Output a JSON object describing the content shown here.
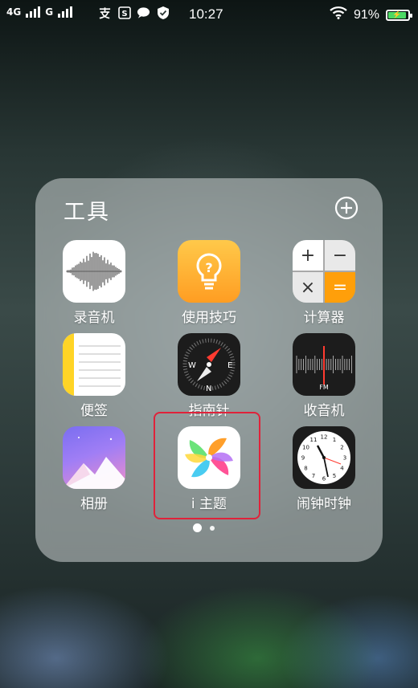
{
  "status_bar": {
    "network1": "4G",
    "network2": "G",
    "time": "10:27",
    "battery_percent": "91%",
    "battery_level": 0.91,
    "icons": [
      "alipay-icon",
      "s-icon",
      "message-icon",
      "shield-check-icon",
      "wifi-icon"
    ]
  },
  "folder": {
    "title": "工具",
    "apps": [
      {
        "label": "录音机",
        "icon": "voice-memos-icon"
      },
      {
        "label": "使用技巧",
        "icon": "tips-icon"
      },
      {
        "label": "计算器",
        "icon": "calculator-icon"
      },
      {
        "label": "便签",
        "icon": "notes-icon"
      },
      {
        "label": "指南针",
        "icon": "compass-icon"
      },
      {
        "label": "收音机",
        "icon": "radio-icon"
      },
      {
        "label": "相册",
        "icon": "photos-icon"
      },
      {
        "label": "i 主题",
        "icon": "theme-icon"
      },
      {
        "label": "闹钟时钟",
        "icon": "clock-icon"
      }
    ],
    "calculator_symbols": [
      "+",
      "−",
      "×",
      "="
    ],
    "compass_letters": [
      "W",
      "E",
      "N"
    ],
    "radio_text": "FM",
    "page_count": 2,
    "current_page": 1
  },
  "colors": {
    "highlight": "#e0223a",
    "battery": "#4cd964",
    "calc_accent": "#ff9f0a",
    "notes_accent": "#ffd426"
  }
}
